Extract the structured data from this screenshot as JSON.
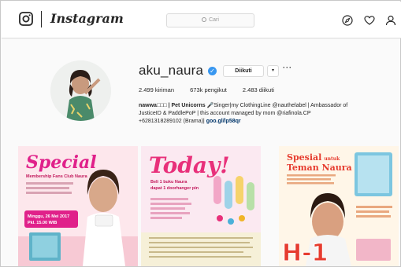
{
  "header": {
    "wordmark": "Instagram",
    "search_placeholder": "Cari"
  },
  "profile": {
    "username": "aku_naura",
    "follow_label": "Diikuti",
    "caret": "▾",
    "more": "···",
    "stats": {
      "posts": "2.499 kiriman",
      "followers": "673k pengikut",
      "following": "2.483 diikuti"
    },
    "bio": {
      "name": "nawwa□□□ | Pet Unicorns ",
      "line1_rest": "Singer|my ClothingLine @nauthelabel | Ambassador of",
      "line2": "JusticeID & PaddlePoP | this account managed by mom @riafinola.CP",
      "line3_phone": "+6281318289102 (Brama)|",
      "link": "goo.gl/lp58qr"
    }
  },
  "posts": [
    {
      "title": "Special",
      "subtitle": "Membership Fans Club Naura",
      "date": "Minggu, 26 Mei 2017",
      "time": "Pkl. 15.00 WIB",
      "accent": "#e0218a"
    },
    {
      "title": "Today!",
      "line1": "Beli 1 buku Naura",
      "line2": "dapat 1 doorhanger pin",
      "accent": "#e8307a"
    },
    {
      "title": "Spesial",
      "title_small": "untuk",
      "title2": "Teman Naura",
      "countdown": "H-1",
      "accent": "#e63b2e"
    }
  ],
  "colors": {
    "link_blue": "#003569",
    "verified_blue": "#3897f0",
    "border": "#dbdbdb"
  }
}
